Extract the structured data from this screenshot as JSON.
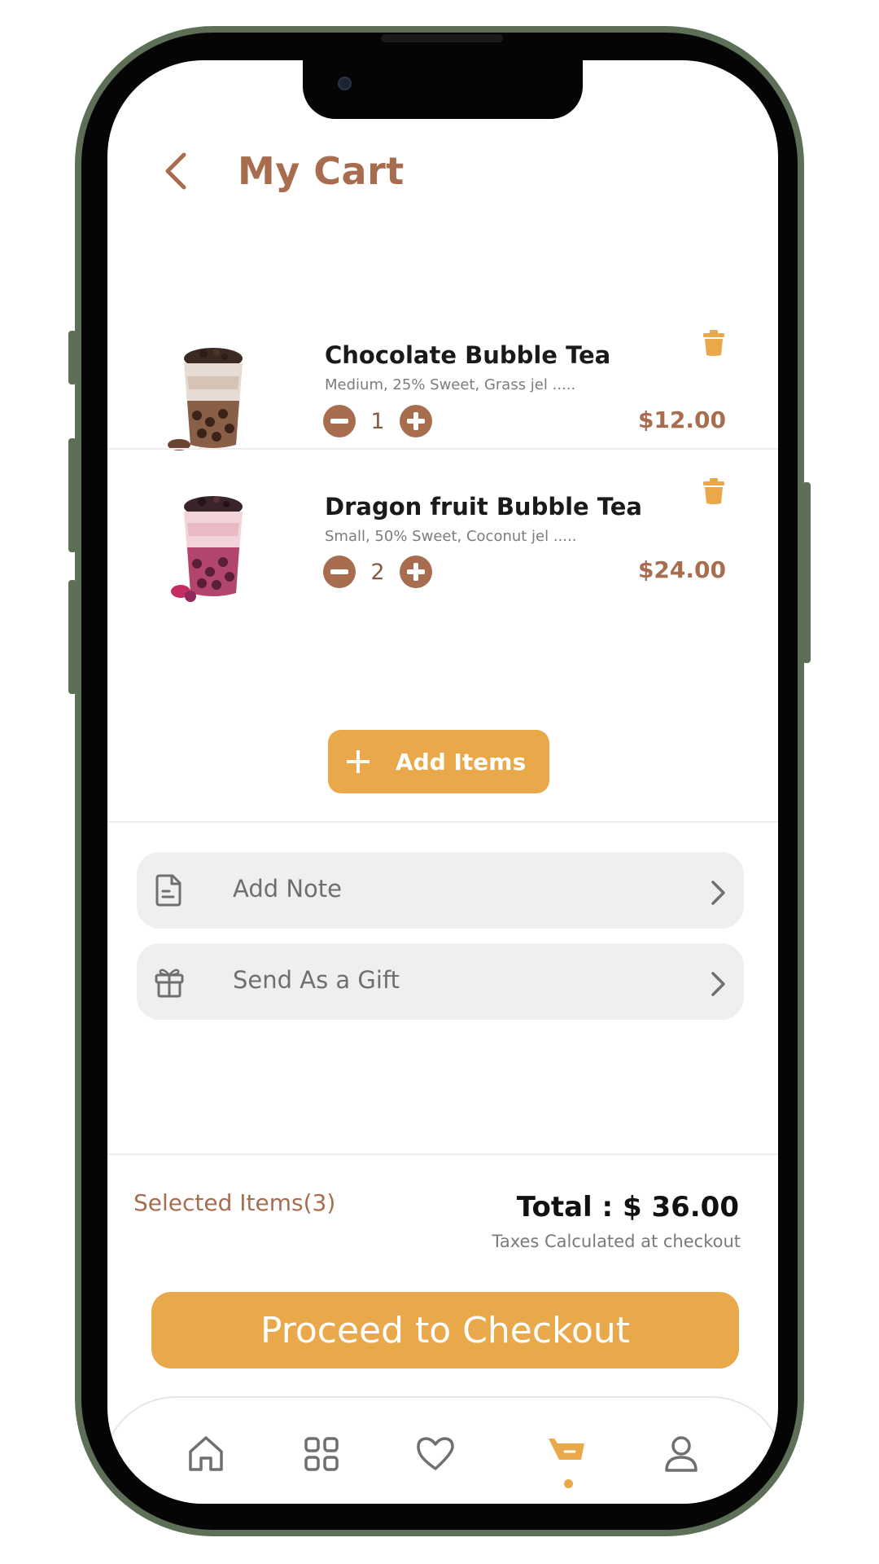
{
  "header": {
    "title": "My Cart"
  },
  "cart": {
    "items": [
      {
        "name": "Chocolate Bubble Tea",
        "description": "Medium, 25% Sweet, Grass jel .....",
        "quantity": "1",
        "price": "$12.00"
      },
      {
        "name": "Dragon fruit Bubble Tea",
        "description": "Small, 50% Sweet, Coconut jel .....",
        "quantity": "2",
        "price": "$24.00"
      }
    ],
    "add_items_label": "Add Items"
  },
  "options": [
    {
      "label": "Add Note",
      "icon": "note-icon"
    },
    {
      "label": "Send As a Gift",
      "icon": "gift-icon"
    }
  ],
  "summary": {
    "selected_items": "Selected Items(3)",
    "total": "Total  : $ 36.00",
    "tax_note": "Taxes Calculated at checkout"
  },
  "checkout_label": "Proceed to Checkout",
  "tabbar": {
    "tabs": [
      {
        "icon": "home-icon"
      },
      {
        "icon": "grid-icon"
      },
      {
        "icon": "heart-icon"
      },
      {
        "icon": "cart-icon",
        "active": true
      },
      {
        "icon": "profile-icon"
      }
    ]
  },
  "colors": {
    "brand_brown": "#a86d4f",
    "accent_orange": "#e9a94a",
    "option_bg": "#efefef",
    "frame_green": "#5d6f57"
  }
}
